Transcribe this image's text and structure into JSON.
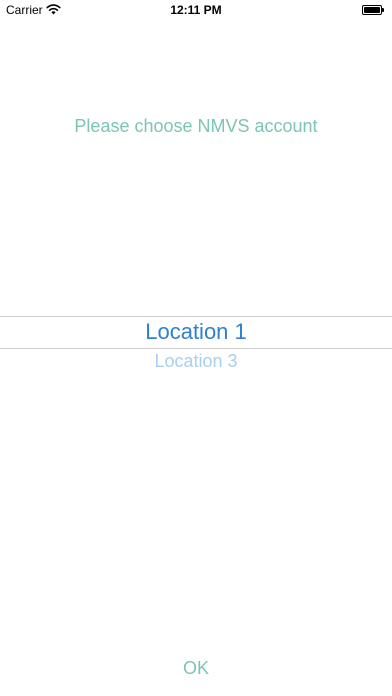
{
  "status_bar": {
    "carrier": "Carrier",
    "time": "12:11 PM"
  },
  "page": {
    "title": "Please choose NMVS account"
  },
  "picker": {
    "selected": "Location 1",
    "next": "Location 3"
  },
  "actions": {
    "ok_label": "OK"
  },
  "colors": {
    "accent": "#7cc4b4",
    "picker_selected": "#2f7fd2",
    "picker_dim": "#a8cff1"
  },
  "icons": {
    "wifi": "wifi-icon",
    "battery": "battery-icon"
  }
}
